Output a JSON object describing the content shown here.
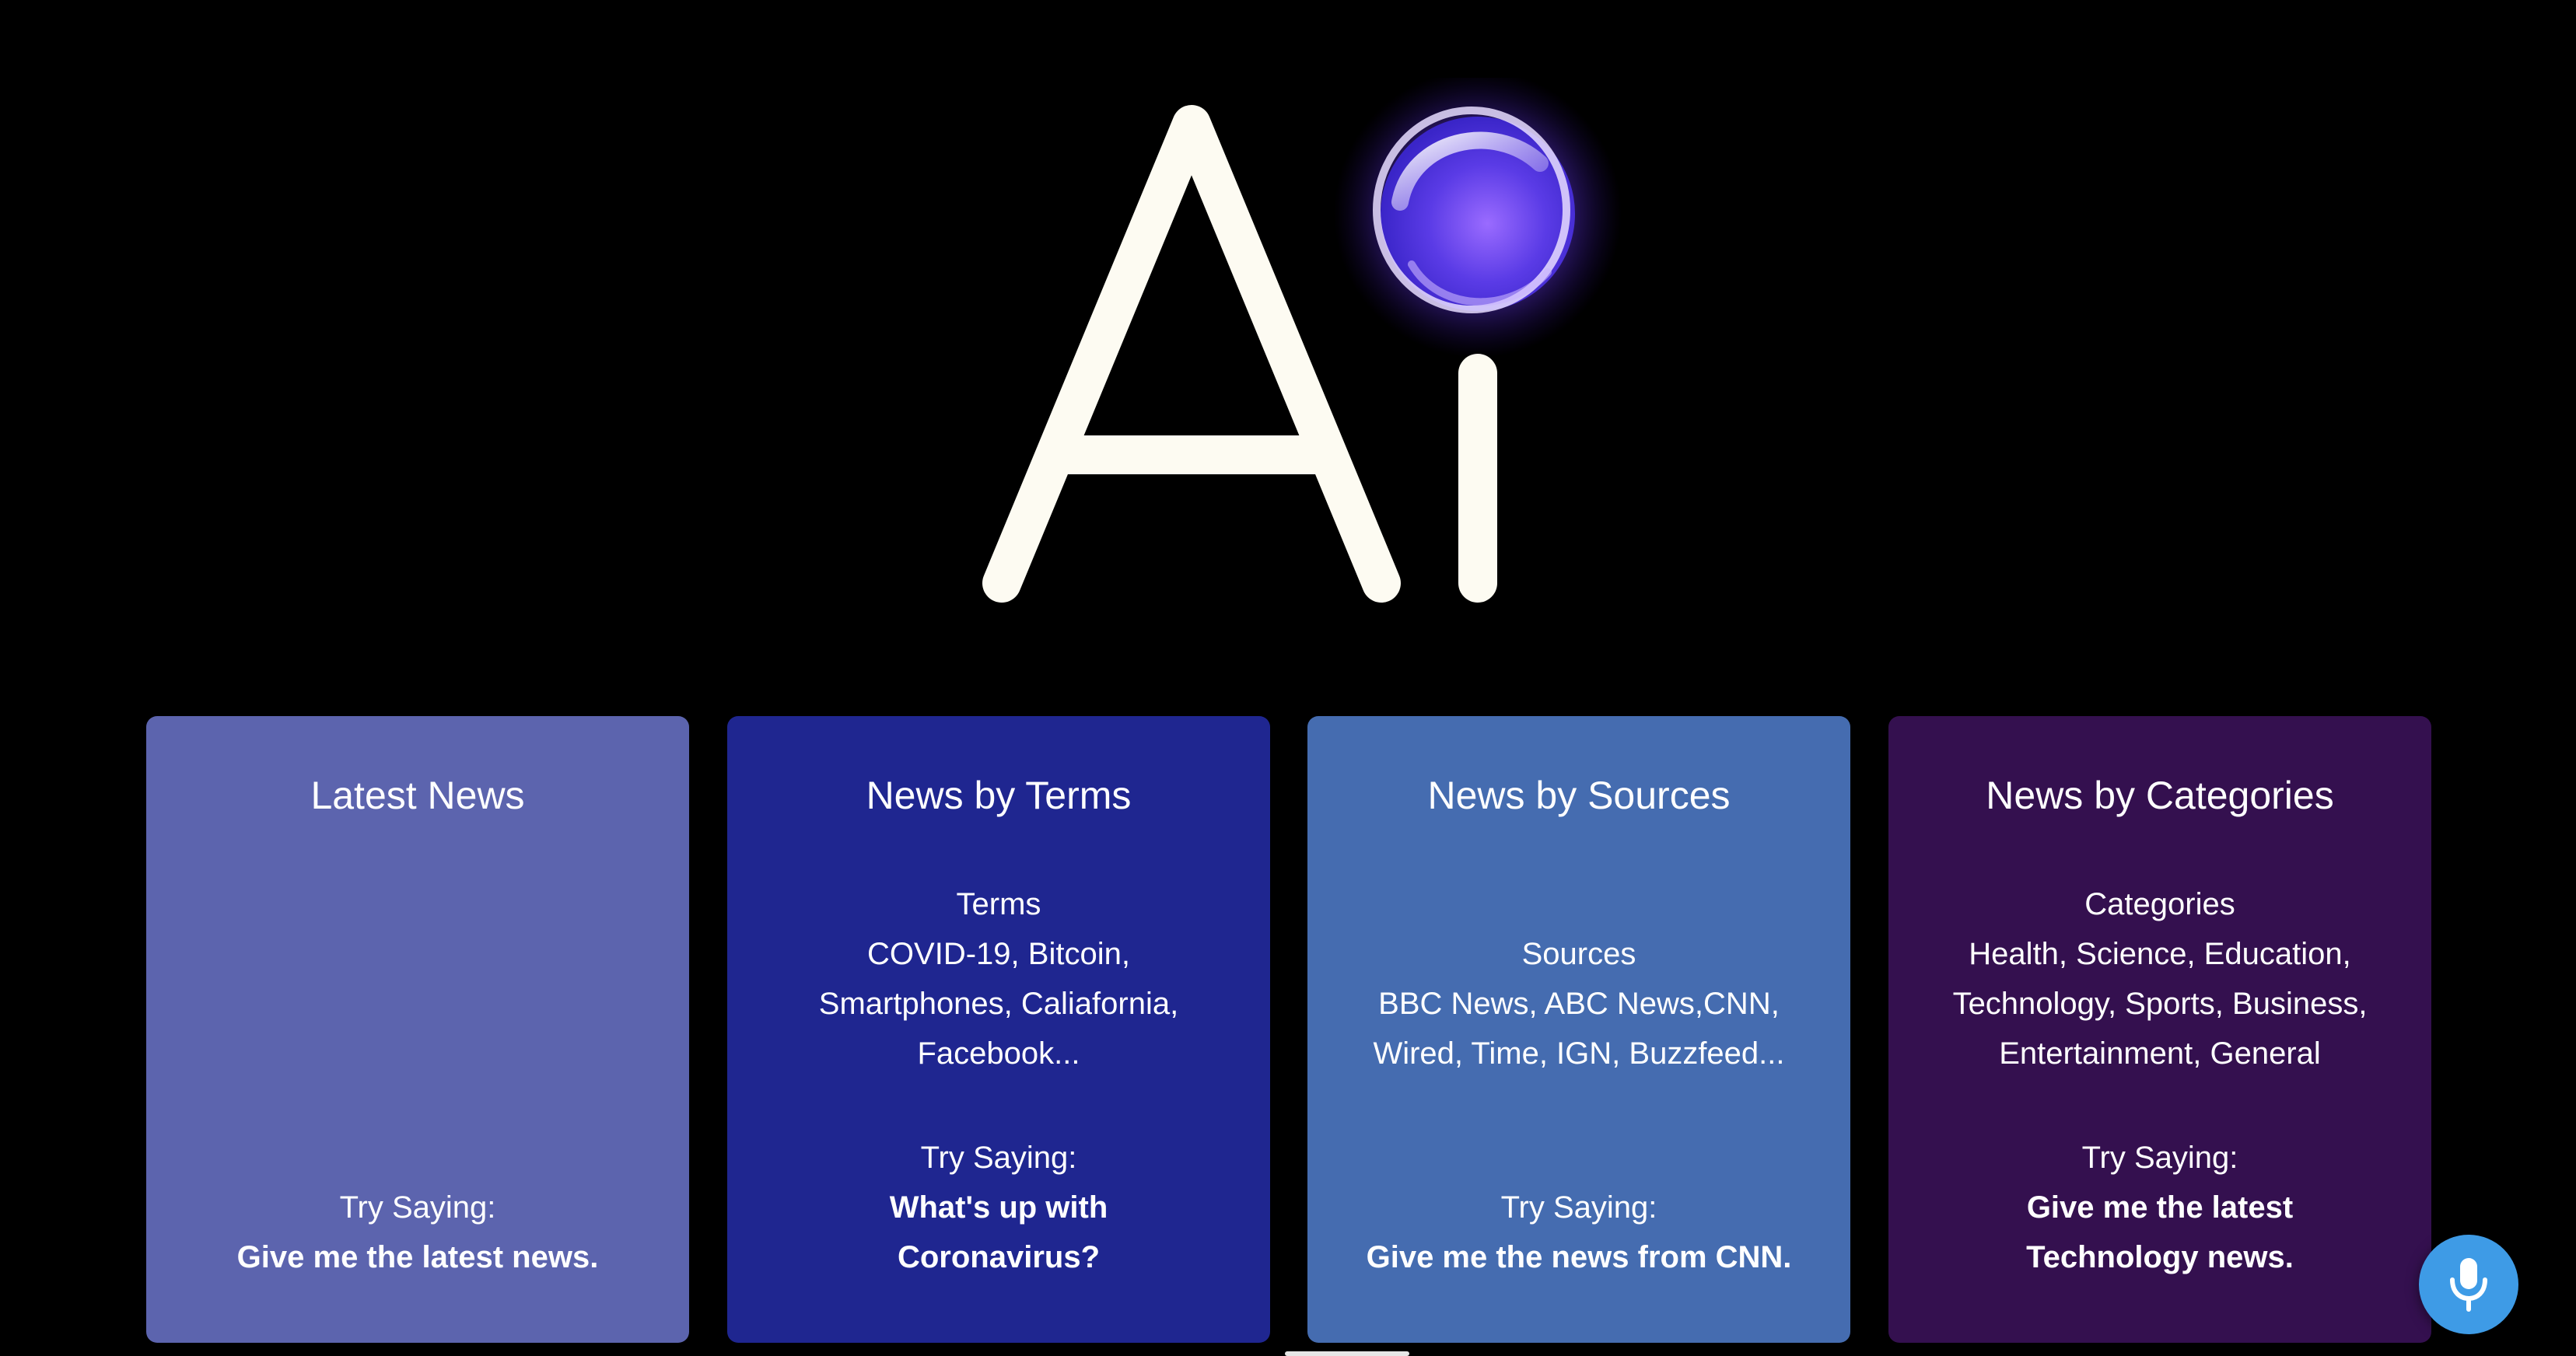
{
  "logo": {
    "text": "Ai",
    "icon": "glowing-orb-icon",
    "colors": {
      "letters": "#fdfbf2",
      "orb_core": "#6b46e8",
      "orb_glow": "#8a5cff"
    }
  },
  "cards": [
    {
      "title": "Latest News",
      "body_heading": "",
      "body_lines": [],
      "try_label": "Try Saying:",
      "example_lines": [
        "Give me the latest news."
      ],
      "color": "#5c64ae"
    },
    {
      "title": "News by Terms",
      "body_heading": "Terms",
      "body_lines": [
        "COVID-19, Bitcoin,",
        "Smartphones, Caliafornia,",
        "Facebook..."
      ],
      "try_label": "Try Saying:",
      "example_lines": [
        "What's up with",
        "Coronavirus?"
      ],
      "color": "#1f2690"
    },
    {
      "title": "News by Sources",
      "body_heading": "Sources",
      "body_lines": [
        "BBC News, ABC News,CNN,",
        "Wired, Time, IGN, Buzzfeed..."
      ],
      "try_label": "Try Saying:",
      "example_lines": [
        "Give me the news from CNN."
      ],
      "color": "#456cb0"
    },
    {
      "title": "News by Categories",
      "body_heading": "Categories",
      "body_lines": [
        "Health, Science, Education,",
        "Technology, Sports, Business,",
        "Entertainment, General"
      ],
      "try_label": "Try Saying:",
      "example_lines": [
        "Give me the latest",
        "Technology news."
      ],
      "color": "#34104f"
    }
  ],
  "mic_button": {
    "icon": "microphone-icon",
    "color": "#3e9be6"
  }
}
